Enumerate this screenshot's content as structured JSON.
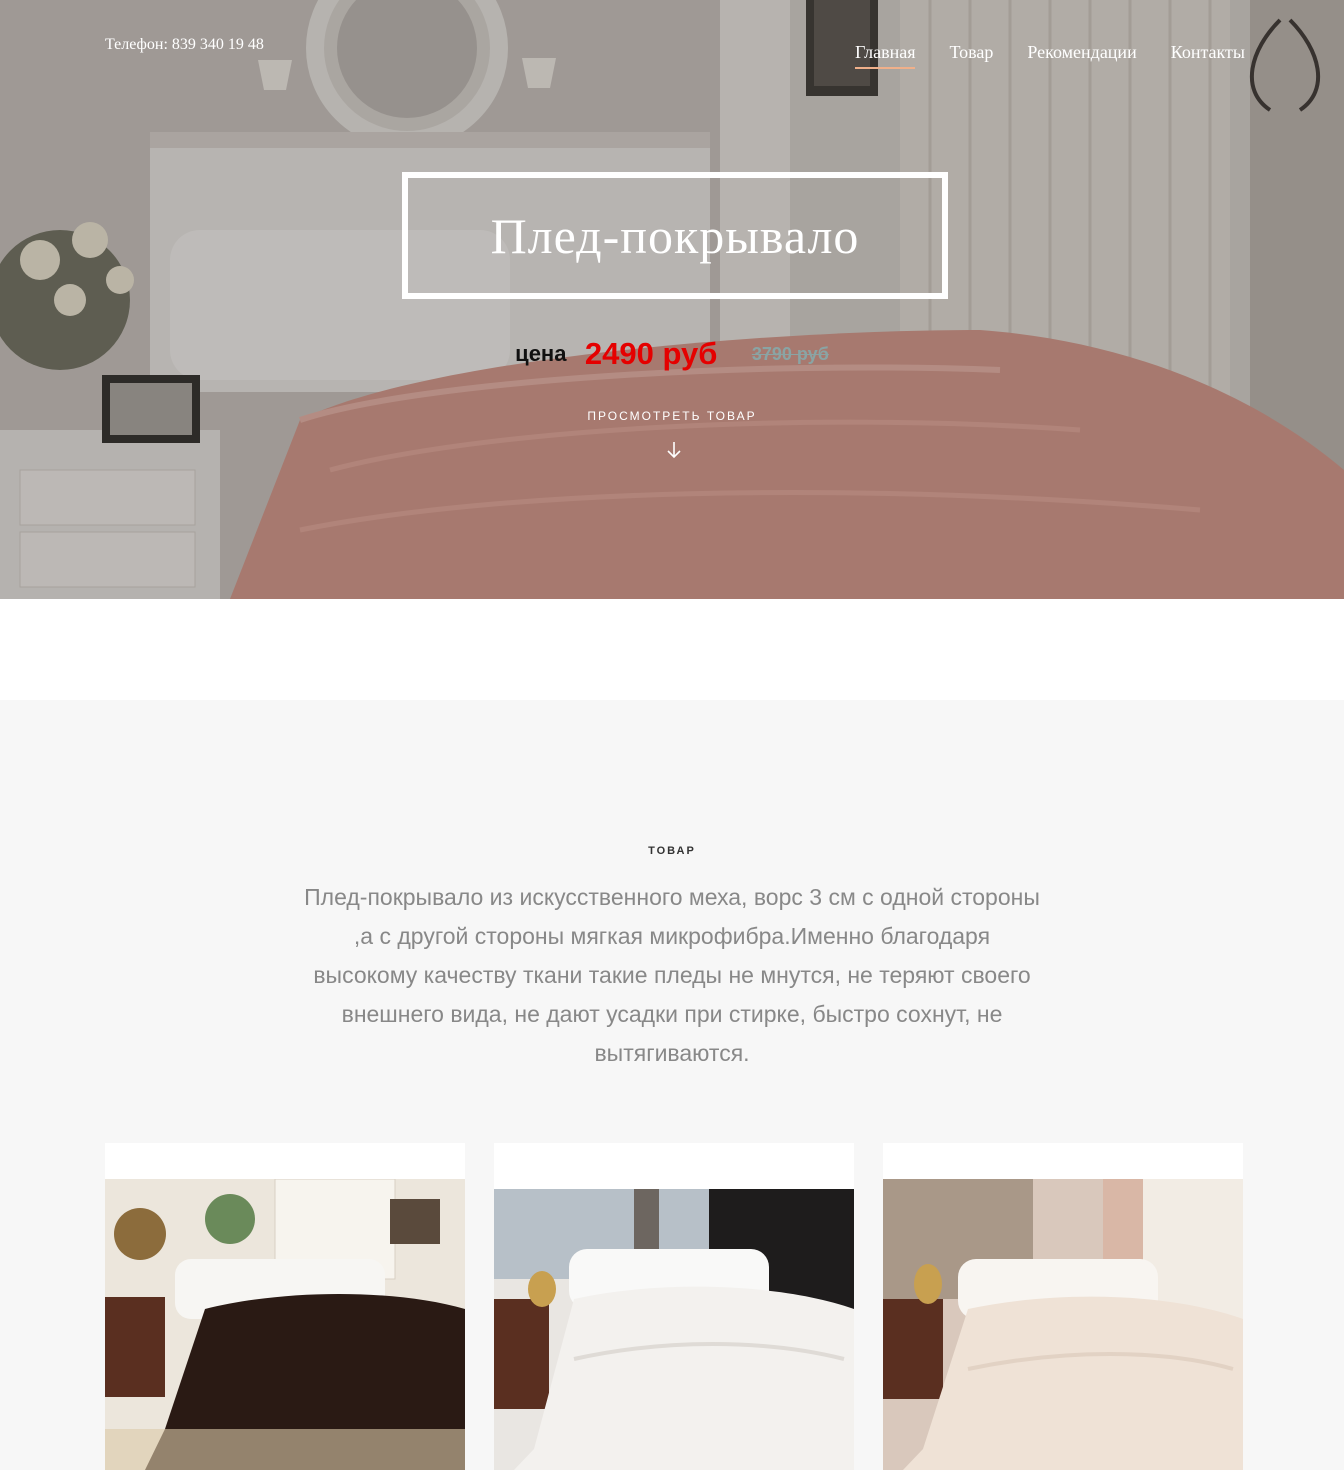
{
  "header": {
    "phone": "Телефон: 839 340 19 48",
    "nav": [
      {
        "label": "Главная",
        "active": true
      },
      {
        "label": "Товар",
        "active": false
      },
      {
        "label": "Рекомендации",
        "active": false
      },
      {
        "label": "Контакты",
        "active": false
      }
    ]
  },
  "hero": {
    "title": "Плед-покрывало",
    "price_label": "цена",
    "price_new": "2490  руб",
    "price_old": "3790  руб",
    "view_link": "ПРОСМОТРЕТЬ ТОВАР",
    "arrow_icon": "arrow-down-icon"
  },
  "product": {
    "section_label": "ТОВАР",
    "description": "Плед-покрывало из искусственного меха, ворс 3 см с одной стороны ,а с другой стороны мягкая микрофибра.Именно благодаря высокому качеству ткани такие пледы не мнутся, не теряют своего внешнего вида, не дают усадки при стирке, быстро сохнут, не вытягиваются.",
    "cards": [
      {
        "name": "dark-brown-throw",
        "blanket_color": "#2a1a14"
      },
      {
        "name": "white-throw",
        "blanket_color": "#f3f1ee"
      },
      {
        "name": "cream-throw",
        "blanket_color": "#efe2d6"
      }
    ]
  },
  "colors": {
    "nav_underline": "#f0b08a",
    "price_new": "#e50000",
    "price_old": "#8aa4a4",
    "section_bg": "#f7f7f7"
  }
}
